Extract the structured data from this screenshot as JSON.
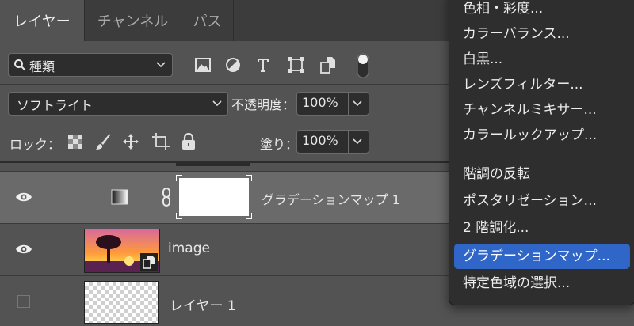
{
  "tabs": [
    {
      "label": "レイヤー"
    },
    {
      "label": "チャンネル"
    },
    {
      "label": "パス"
    }
  ],
  "filter": {
    "kind_label": "種類"
  },
  "blend": {
    "mode": "ソフトライト",
    "opacity_label": "不透明度：",
    "opacity_value": "100%"
  },
  "lock": {
    "label": "ロック：",
    "fill_label": "塗り：",
    "fill_value": "100%"
  },
  "layers": [
    {
      "name": "グラデーションマップ 1",
      "visible": true
    },
    {
      "name": "image",
      "visible": true
    },
    {
      "name": "レイヤー 1",
      "visible": false
    }
  ],
  "menu": {
    "items_top": [
      {
        "label": "色相・彩度..."
      },
      {
        "label": "カラーバランス..."
      },
      {
        "label": "白黒..."
      },
      {
        "label": "レンズフィルター..."
      },
      {
        "label": "チャンネルミキサー..."
      },
      {
        "label": "カラールックアップ..."
      }
    ],
    "items_bottom": [
      {
        "label": "階調の反転"
      },
      {
        "label": "ポスタリゼーション..."
      },
      {
        "label": "2 階調化..."
      },
      {
        "label": "グラデーションマップ...",
        "highlighted": true
      },
      {
        "label": "特定色域の選択..."
      }
    ]
  },
  "colors": {
    "highlight": "#2f66c8",
    "panel": "#535353",
    "menu_bg": "#2e2e2e"
  }
}
